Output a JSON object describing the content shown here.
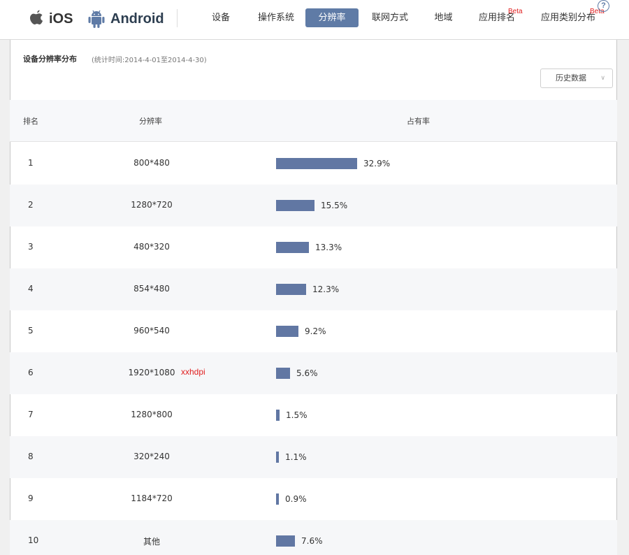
{
  "header": {
    "platforms": [
      {
        "name": "ios",
        "label": "iOS"
      },
      {
        "name": "android",
        "label": "Android"
      }
    ],
    "tabs": [
      {
        "label": "设备",
        "active": false
      },
      {
        "label": "操作系统",
        "active": false
      },
      {
        "label": "分辨率",
        "active": true
      },
      {
        "label": "联网方式",
        "active": false
      },
      {
        "label": "地域",
        "active": false
      },
      {
        "label": "应用排名",
        "active": false,
        "badge": "Beta"
      },
      {
        "label": "应用类别分布",
        "active": false,
        "badge": "Beta"
      }
    ],
    "help": "?"
  },
  "section": {
    "title": "设备分辨率分布",
    "subtitle": "(统计时间:2014-4-01至2014-4-30)",
    "history_button": "历史数据"
  },
  "table": {
    "headers": {
      "rank": "排名",
      "resolution": "分辨率",
      "share": "占有率"
    },
    "rows": [
      {
        "rank": "1",
        "resolution": "800*480",
        "note": "",
        "share": 32.9,
        "share_label": "32.9%"
      },
      {
        "rank": "2",
        "resolution": "1280*720",
        "note": "",
        "share": 15.5,
        "share_label": "15.5%"
      },
      {
        "rank": "3",
        "resolution": "480*320",
        "note": "",
        "share": 13.3,
        "share_label": "13.3%"
      },
      {
        "rank": "4",
        "resolution": "854*480",
        "note": "",
        "share": 12.3,
        "share_label": "12.3%"
      },
      {
        "rank": "5",
        "resolution": "960*540",
        "note": "",
        "share": 9.2,
        "share_label": "9.2%"
      },
      {
        "rank": "6",
        "resolution": "1920*1080",
        "note": "xxhdpi",
        "share": 5.6,
        "share_label": "5.6%"
      },
      {
        "rank": "7",
        "resolution": "1280*800",
        "note": "",
        "share": 1.5,
        "share_label": "1.5%"
      },
      {
        "rank": "8",
        "resolution": "320*240",
        "note": "",
        "share": 1.1,
        "share_label": "1.1%"
      },
      {
        "rank": "9",
        "resolution": "1184*720",
        "note": "",
        "share": 0.9,
        "share_label": "0.9%"
      },
      {
        "rank": "10",
        "resolution": "其他",
        "note": "",
        "share": 7.6,
        "share_label": "7.6%"
      }
    ]
  },
  "colors": {
    "accent": "#5f7ba6",
    "bar": "#6177a3",
    "badge": "#e02020"
  }
}
